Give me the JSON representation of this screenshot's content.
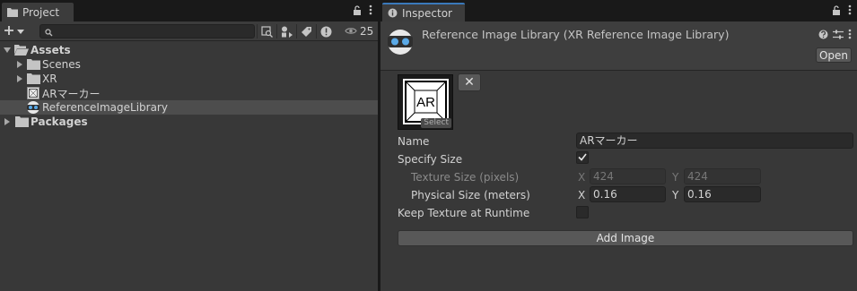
{
  "project": {
    "tab_label": "Project",
    "tab_icon": "folder-icon",
    "hidden_count": "25",
    "tree": {
      "assets": "Assets",
      "scenes": "Scenes",
      "xr": "XR",
      "ar_marker": "ARマーカー",
      "reference_library": "ReferenceImageLibrary",
      "packages": "Packages"
    }
  },
  "inspector": {
    "tab_label": "Inspector",
    "title": "Reference Image Library (XR Reference Image Library)",
    "open_label": "Open",
    "thumb_select": "Select",
    "thumb_text": "AR",
    "remove_label": "✕",
    "props": {
      "name_label": "Name",
      "name_value": "ARマーカー",
      "specify_size_label": "Specify Size",
      "specify_size_checked": true,
      "texture_size_label": "Texture Size (pixels)",
      "texture_x": "424",
      "texture_y": "424",
      "physical_size_label": "Physical Size (meters)",
      "physical_x": "0.16",
      "physical_y": "0.16",
      "x_axis": "X",
      "y_axis": "Y",
      "keep_texture_label": "Keep Texture at Runtime",
      "keep_texture_checked": false
    },
    "add_image_label": "Add Image"
  },
  "colors": {
    "panel_bg": "#383838",
    "tabbar_bg": "#191919",
    "selection_bg": "#4d4d4d",
    "field_bg": "#2a2a2a",
    "button_bg": "#585858",
    "text": "#d2d2d2"
  }
}
